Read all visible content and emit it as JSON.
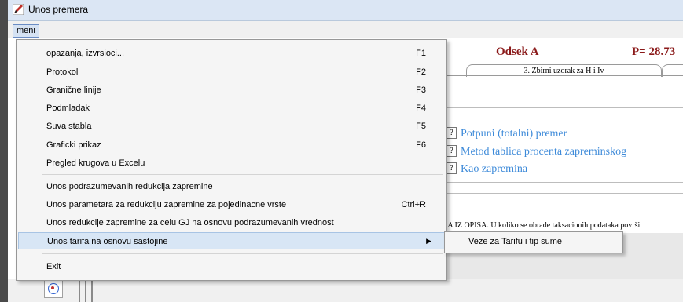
{
  "window": {
    "title": "Unos premera"
  },
  "menubar": {
    "menu_label": "meni"
  },
  "header": {
    "odsek": "Odsek A",
    "p_value": "P= 28.73"
  },
  "tabs": [
    {
      "label": "3. Zbirni uzorak za H i Iv"
    }
  ],
  "options": [
    {
      "label": "Potpuni (totalni) premer"
    },
    {
      "label": "Metod tablica procenta zapreminskog"
    },
    {
      "label": "Kao zapremina"
    }
  ],
  "note": "IA IZ OPISA. U koliko se obrade taksacionih podataka površi",
  "menu": {
    "items": [
      {
        "label": "opazanja, izvrsioci...",
        "shortcut": "F1"
      },
      {
        "label": "Protokol",
        "shortcut": "F2"
      },
      {
        "label": "Granične linije",
        "shortcut": "F3"
      },
      {
        "label": "Podmladak",
        "shortcut": "F4"
      },
      {
        "label": "Suva stabla",
        "shortcut": "F5"
      },
      {
        "label": "Graficki prikaz",
        "shortcut": "F6"
      },
      {
        "label": "Pregled krugova u Excelu",
        "shortcut": ""
      },
      {
        "label": "Unos podrazumevanih redukcija zapremine",
        "shortcut": ""
      },
      {
        "label": "Unos parametara za redukciju zapremine za pojedinacne vrste",
        "shortcut": "Ctrl+R"
      },
      {
        "label": "Unos redukcije zapremine za celu GJ na osnovu podrazumevanih vrednost",
        "shortcut": ""
      },
      {
        "label": "Unos tarifa na osnovu sastojine",
        "shortcut": ""
      },
      {
        "label": "Exit",
        "shortcut": ""
      }
    ]
  },
  "submenu": {
    "items": [
      {
        "label": "Veze za Tarifu i tip sume"
      }
    ]
  },
  "colors": {
    "accent": "#3d8ad9",
    "header_red": "#8b1a1a",
    "highlight": "#d8e6f5"
  }
}
